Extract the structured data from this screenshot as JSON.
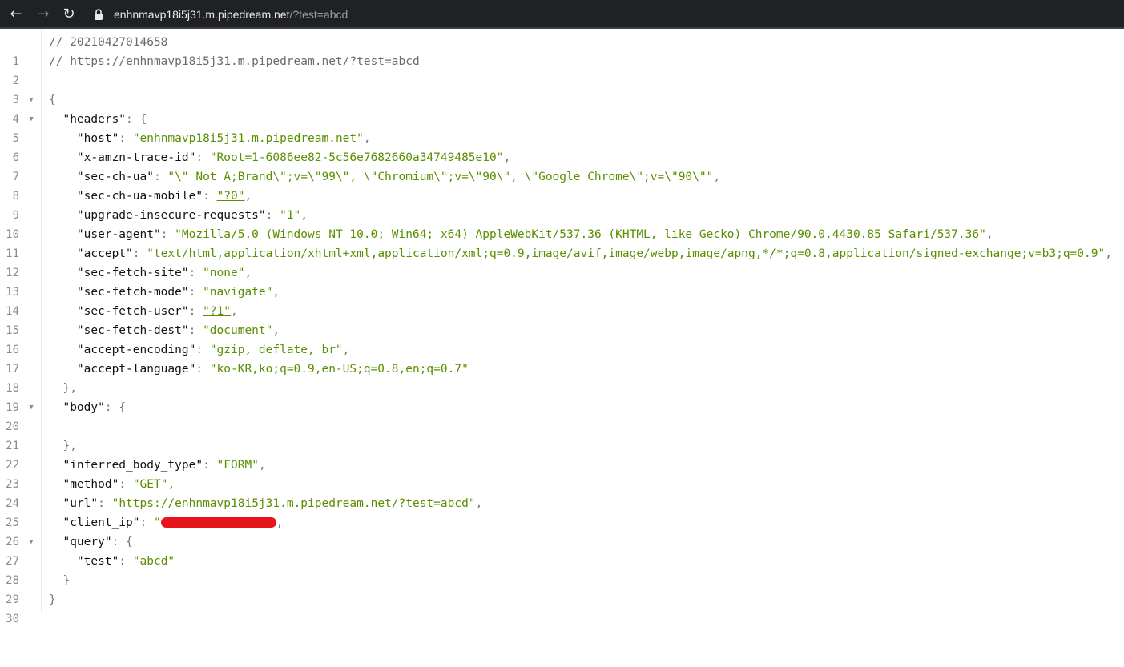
{
  "browser": {
    "url_host": "enhnmavp18i5j31.m.pipedream.net",
    "url_path": "/?test=abcd",
    "icons": {
      "back": "back-arrow-icon",
      "forward": "forward-arrow-icon",
      "reload": "reload-icon",
      "lock": "lock-icon"
    },
    "colors": {
      "toolbar": "#202124",
      "url_text": "#e8eaed",
      "url_path": "#9aa0a6"
    }
  },
  "viewer": {
    "line_numbers": [
      "1",
      "2",
      "3",
      "4",
      "5",
      "6",
      "7",
      "8",
      "9",
      "10",
      "11",
      "12",
      "13",
      "14",
      "15",
      "16",
      "17",
      "18",
      "19",
      "20",
      "21",
      "22",
      "23",
      "24",
      "25",
      "26",
      "27",
      "28",
      "29",
      "30"
    ],
    "comments": {
      "timestamp": "// 20210427014658",
      "source_url": "// https://enhnmavp18i5j31.m.pipedream.net/?test=abcd"
    },
    "json": {
      "headers_key": "\"headers\"",
      "headers": [
        {
          "key": "\"host\"",
          "value": "\"enhnmavp18i5j31.m.pipedream.net\""
        },
        {
          "key": "\"x-amzn-trace-id\"",
          "value": "\"Root=1-6086ee82-5c56e7682660a34749485e10\""
        },
        {
          "key": "\"sec-ch-ua\"",
          "value": "\"\\\" Not A;Brand\\\";v=\\\"99\\\", \\\"Chromium\\\";v=\\\"90\\\", \\\"Google Chrome\\\";v=\\\"90\\\"\""
        },
        {
          "key": "\"sec-ch-ua-mobile\"",
          "value": "\"?0\""
        },
        {
          "key": "\"upgrade-insecure-requests\"",
          "value": "\"1\""
        },
        {
          "key": "\"user-agent\"",
          "value": "\"Mozilla/5.0 (Windows NT 10.0; Win64; x64) AppleWebKit/537.36 (KHTML, like Gecko) Chrome/90.0.4430.85 Safari/537.36\""
        },
        {
          "key": "\"accept\"",
          "value": "\"text/html,application/xhtml+xml,application/xml;q=0.9,image/avif,image/webp,image/apng,*/*;q=0.8,application/signed-exchange;v=b3;q=0.9\""
        },
        {
          "key": "\"sec-fetch-site\"",
          "value": "\"none\""
        },
        {
          "key": "\"sec-fetch-mode\"",
          "value": "\"navigate\""
        },
        {
          "key": "\"sec-fetch-user\"",
          "value": "\"?1\""
        },
        {
          "key": "\"sec-fetch-dest\"",
          "value": "\"document\""
        },
        {
          "key": "\"accept-encoding\"",
          "value": "\"gzip, deflate, br\""
        },
        {
          "key": "\"accept-language\"",
          "value": "\"ko-KR,ko;q=0.9,en-US;q=0.8,en;q=0.7\""
        }
      ],
      "body_key": "\"body\"",
      "inferred_body_type": {
        "key": "\"inferred_body_type\"",
        "value": "\"FORM\""
      },
      "method": {
        "key": "\"method\"",
        "value": "\"GET\""
      },
      "url": {
        "key": "\"url\"",
        "value": "\"https://enhnmavp18i5j31.m.pipedream.net/?test=abcd\""
      },
      "client_ip": {
        "key": "\"client_ip\"",
        "value_prefix": "\""
      },
      "query_key": "\"query\"",
      "query": {
        "key": "\"test\"",
        "value": "\"abcd\""
      }
    },
    "colors": {
      "string": "#5a8f00",
      "key": "#111111",
      "comment": "#6b6b6b",
      "line_number": "#8c8c8c",
      "redaction": "#e8161b"
    }
  }
}
